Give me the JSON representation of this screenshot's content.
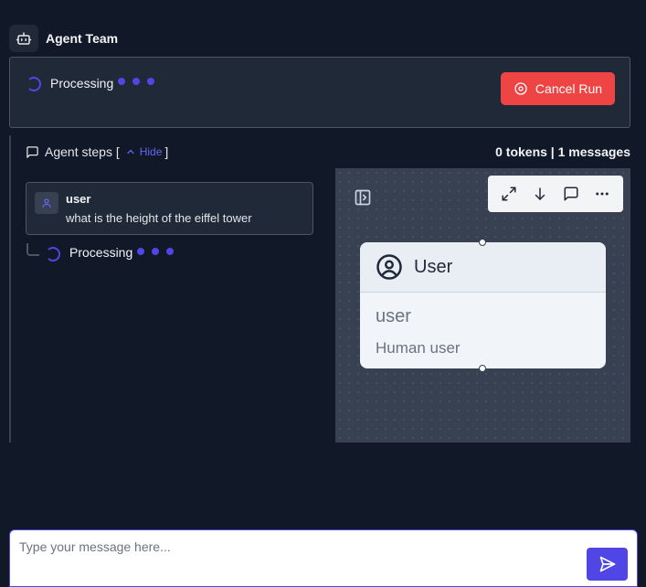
{
  "header": {
    "title": "Agent Team",
    "icon": "bot-icon"
  },
  "status": {
    "label": "Processing",
    "cancel_label": "Cancel Run",
    "cancel_color": "#ef4444"
  },
  "steps": {
    "label": "Agent steps [",
    "hide_label": "Hide",
    "close_bracket": "]",
    "token_info": "0 tokens | 1 messages"
  },
  "messages": [
    {
      "sender": "user",
      "text": "what is the height of the eiffel tower"
    }
  ],
  "sub_status": {
    "label": "Processing"
  },
  "canvas": {
    "toolbar": [
      "expand-icon",
      "arrow-down-icon",
      "message-icon",
      "more-icon"
    ],
    "node": {
      "title": "User",
      "name": "user",
      "description": "Human user"
    }
  },
  "chat": {
    "placeholder": "Type your message here...",
    "value": ""
  },
  "colors": {
    "accent": "#4f46e5",
    "background": "#111827",
    "panel": "#1f2937"
  }
}
